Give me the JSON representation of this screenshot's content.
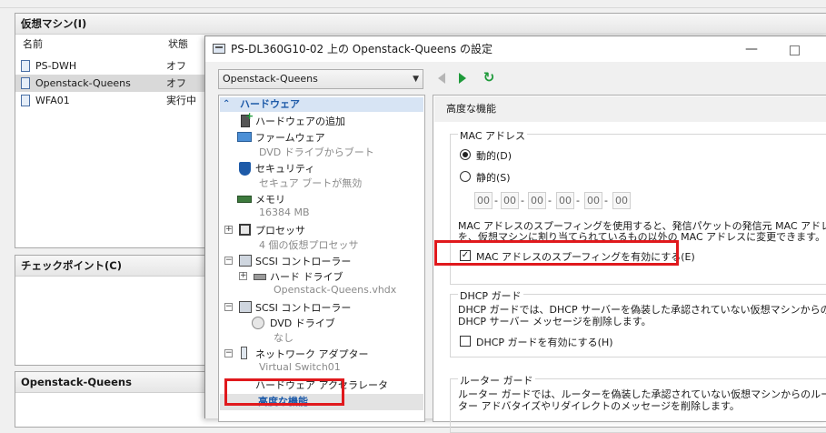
{
  "manager": {
    "vm_panel_title": "仮想マシン(I)",
    "col_name": "名前",
    "col_state": "状態",
    "vms": [
      {
        "name": "PS-DWH",
        "state": "オフ"
      },
      {
        "name": "Openstack-Queens",
        "state": "オフ"
      },
      {
        "name": "WFA01",
        "state": "実行中"
      }
    ],
    "checkpoint_title": "チェックポイント(C)",
    "detail_title": "Openstack-Queens"
  },
  "dialog": {
    "title": "PS-DL360G10-02 上の Openstack-Queens の設定",
    "vm_selector": "Openstack-Queens",
    "tree": {
      "hardware_header": "ハードウェア",
      "add_hardware": "ハードウェアの追加",
      "firmware": "ファームウェア",
      "firmware_sub": "DVD ドライブからブート",
      "security": "セキュリティ",
      "security_sub": "セキュア ブートが無効",
      "memory": "メモリ",
      "memory_sub": "16384 MB",
      "processor": "プロセッサ",
      "processor_sub": "4 個の仮想プロセッサ",
      "scsi1": "SCSI コントローラー",
      "hard_drive": "ハード ドライブ",
      "hard_drive_sub": "Openstack-Queens.vhdx",
      "scsi2": "SCSI コントローラー",
      "dvd": "DVD ドライブ",
      "dvd_sub": "なし",
      "network": "ネットワーク アダプター",
      "network_sub": "Virtual Switch01",
      "hw_accel": "ハードウェア アクセラレータ",
      "advanced": "高度な機能"
    },
    "pane": {
      "header": "高度な機能",
      "mac_group": "MAC アドレス",
      "dynamic": "動的(D)",
      "static": "静的(S)",
      "mac_octets": [
        "00",
        "00",
        "00",
        "00",
        "00",
        "00"
      ],
      "spoof_desc_1": "MAC アドレスのスプーフィングを使用すると、発信パケットの発信元 MAC アドレス",
      "spoof_desc_2": "を、仮想マシンに割り当てられているもの以外の MAC アドレスに変更できます。",
      "spoof_checkbox": "MAC アドレスのスプーフィングを有効にする(E)",
      "dhcp_group": "DHCP ガード",
      "dhcp_desc_1": "DHCP ガードでは、DHCP サーバーを偽装した承認されていない仮想マシンからの",
      "dhcp_desc_2": "DHCP サーバー メッセージを削除します。",
      "dhcp_checkbox": "DHCP ガードを有効にする(H)",
      "router_group": "ルーター ガード",
      "router_desc_1": "ルーター ガードでは、ルーターを偽装した承認されていない仮想マシンからのルー",
      "router_desc_2": "ター アドバタイズやリダイレクトのメッセージを削除します。"
    },
    "spoof_checked": true,
    "dhcp_checked": false,
    "dynamic_selected": true
  },
  "highlight_color": "#e0191d"
}
